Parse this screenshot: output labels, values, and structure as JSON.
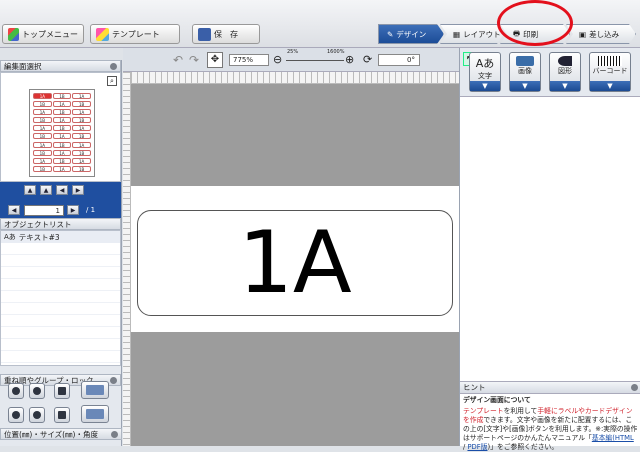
{
  "toolbar": {
    "top_menu": "トップメニュー",
    "template": "テンプレート",
    "save": "保　存"
  },
  "steps": [
    {
      "label": "デザイン"
    },
    {
      "label": "レイアウト"
    },
    {
      "label": "印刷"
    },
    {
      "label": "差し込み"
    }
  ],
  "canvas_toolbar": {
    "zoom": "775%",
    "slider_min": "25%",
    "slider_max": "1600%",
    "rotation": "0°"
  },
  "left_panel": {
    "edit_select_title": "編集面選択",
    "thumb_cells": [
      "1A",
      "1B",
      "1A",
      "1B",
      "1A",
      "1B",
      "1A",
      "1B",
      "1A",
      "1B",
      "1A",
      "1B",
      "1A",
      "1B",
      "1A",
      "1B",
      "1A",
      "1B",
      "1A",
      "1B",
      "1A",
      "1B",
      "1A",
      "1B",
      "1A",
      "1B",
      "1A",
      "1B",
      "1A",
      "1B"
    ],
    "page_value": "1",
    "page_total": "/ 1",
    "object_list_title": "オブジェクトリスト",
    "objects": [
      {
        "name": "テキスト#3",
        "icon": "text-object-icon"
      }
    ],
    "order_title": "重ね順やグループ・ロック",
    "position_title": "位置(㎜)・サイズ(㎜)・角度"
  },
  "canvas": {
    "label_text": "1A"
  },
  "right_panel": {
    "tools": [
      {
        "label": "文字",
        "icon": "text-tool-icon"
      },
      {
        "label": "画像",
        "icon": "image-tool-icon"
      },
      {
        "label": "図形",
        "icon": "shape-tool-icon"
      },
      {
        "label": "バーコード",
        "icon": "barcode-tool-icon"
      }
    ],
    "hint_title": "ヒント",
    "hint_heading": "デザイン画面について",
    "hint_red": "テンプレート",
    "hint_1": "を利用して",
    "hint_red2": "手軽にラベルやカードデザインを作成",
    "hint_2": "できます。文字や画像を新たに配置するには、この上の[文字]や[画像]ボタンを利用します。",
    "hint_3": "※:実際の操作はサポートページのかんたんマニュアル「",
    "hint_link1": "基本編(HTML",
    "hint_sep": " / ",
    "hint_link2": "PDF版",
    "hint_4": ")」をご参照ください。",
    "hint_5": "※サポートページ",
    "hint_link3": "よくあるご質問",
    "hint_6": "もご参照ください。"
  },
  "colors": {
    "accent": "#1f4fa0",
    "annotation": "#e3101c"
  }
}
